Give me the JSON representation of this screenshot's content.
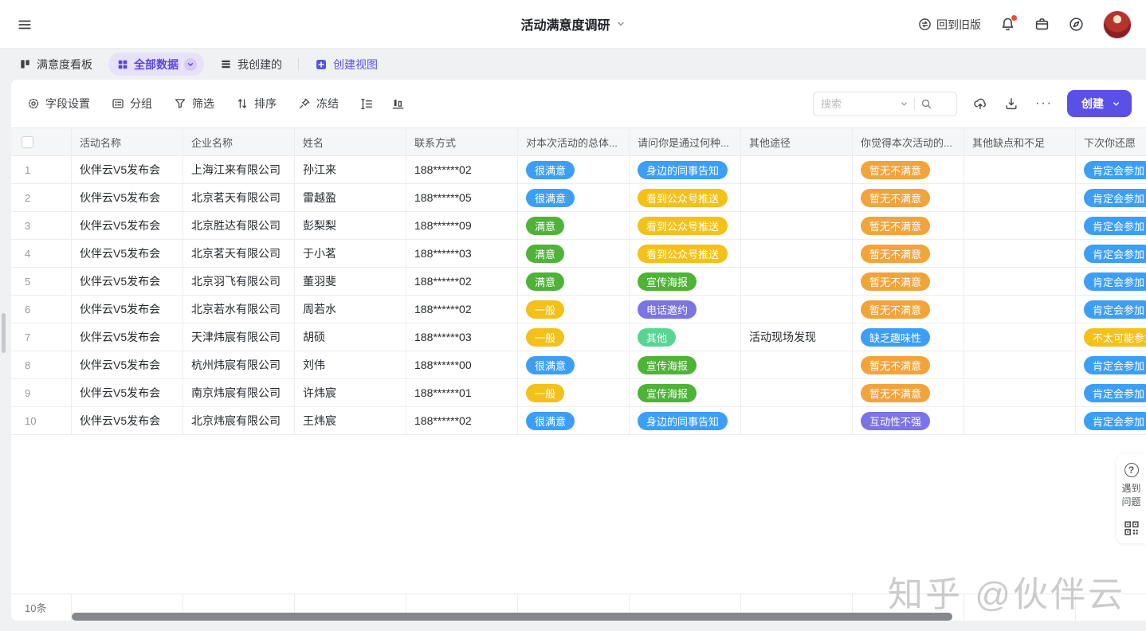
{
  "header": {
    "title": "活动满意度调研",
    "back_to_old_label": "回到旧版"
  },
  "tabs": {
    "kanban_label": "满意度看板",
    "all_data_label": "全部数据",
    "my_created_label": "我创建的",
    "create_view_label": "创建视图"
  },
  "toolbar": {
    "field_settings_label": "字段设置",
    "group_label": "分组",
    "filter_label": "筛选",
    "sort_label": "排序",
    "freeze_label": "冻结",
    "search_placeholder": "搜索",
    "create_label": "创建"
  },
  "colors": {
    "brand_purple": "#5b50e6",
    "tab_pill_bg": "#e7e1fa",
    "tab_pill_text": "#5b44e0"
  },
  "icons": {
    "menu": "hamburger",
    "title_caret": "chevron-down",
    "back_to_old": "circular-swap-arrows",
    "notifications": "bell-with-red-dot",
    "workspace": "briefcase",
    "discover": "compass",
    "kanban_view": "kanban-board",
    "all_data_view": "grid-2x2",
    "my_created_view": "list-rows",
    "create_view": "plus-square",
    "field_settings": "gear",
    "group": "grouping-panel",
    "filter": "funnel",
    "sort": "arrows-up-down",
    "freeze": "pin",
    "row_height": "row-height-ruler",
    "chart": "bar-chart",
    "search": "magnifier",
    "upload": "cloud-up-arrow",
    "download": "down-arrow-tray",
    "more": "ellipsis",
    "help": "question-circle",
    "qr": "qr-code"
  },
  "table": {
    "tag_colors": {
      "blue": "#3d9ef5",
      "green": "#4eb337",
      "yellow": "#f3c117",
      "orange": "#f2a43c",
      "indigo": "#7b74e3",
      "mint": "#56d692"
    },
    "columns": [
      {
        "key": "activity",
        "label": "活动名称",
        "type": "text"
      },
      {
        "key": "company",
        "label": "企业名称",
        "type": "text"
      },
      {
        "key": "person",
        "label": "姓名",
        "type": "text"
      },
      {
        "key": "phone",
        "label": "联系方式",
        "type": "text"
      },
      {
        "key": "overall",
        "label": "对本次活动的总体...",
        "type": "tag"
      },
      {
        "key": "channel",
        "label": "请问你是通过何种...",
        "type": "tag"
      },
      {
        "key": "other_channel",
        "label": "其他途径",
        "type": "text"
      },
      {
        "key": "dislike",
        "label": "你觉得本次活动的...",
        "type": "tag"
      },
      {
        "key": "other_dislike",
        "label": "其他缺点和不足",
        "type": "text"
      },
      {
        "key": "next_join",
        "label": "下次你还愿",
        "type": "tag"
      }
    ],
    "rows": [
      {
        "num": "1",
        "activity": "伙伴云V5发布会",
        "company": "上海江来有限公司",
        "person": "孙江来",
        "phone": "188******02",
        "overall": {
          "label": "很满意",
          "color": "blue"
        },
        "channel": {
          "label": "身边的同事告知",
          "color": "blue"
        },
        "other_channel": "",
        "dislike": {
          "label": "暂无不满意",
          "color": "orange"
        },
        "other_dislike": "",
        "next_join": {
          "label": "肯定会参加",
          "color": "blue"
        }
      },
      {
        "num": "2",
        "activity": "伙伴云V5发布会",
        "company": "北京茗天有限公司",
        "person": "雷越盈",
        "phone": "188******05",
        "overall": {
          "label": "很满意",
          "color": "blue"
        },
        "channel": {
          "label": "看到公众号推送",
          "color": "yellow"
        },
        "other_channel": "",
        "dislike": {
          "label": "暂无不满意",
          "color": "orange"
        },
        "other_dislike": "",
        "next_join": {
          "label": "肯定会参加",
          "color": "blue"
        }
      },
      {
        "num": "3",
        "activity": "伙伴云V5发布会",
        "company": "北京胜达有限公司",
        "person": "彭梨梨",
        "phone": "188******09",
        "overall": {
          "label": "满意",
          "color": "green"
        },
        "channel": {
          "label": "看到公众号推送",
          "color": "yellow"
        },
        "other_channel": "",
        "dislike": {
          "label": "暂无不满意",
          "color": "orange"
        },
        "other_dislike": "",
        "next_join": {
          "label": "肯定会参加",
          "color": "blue"
        }
      },
      {
        "num": "4",
        "activity": "伙伴云V5发布会",
        "company": "北京茗天有限公司",
        "person": "于小茗",
        "phone": "188******03",
        "overall": {
          "label": "满意",
          "color": "green"
        },
        "channel": {
          "label": "看到公众号推送",
          "color": "yellow"
        },
        "other_channel": "",
        "dislike": {
          "label": "暂无不满意",
          "color": "orange"
        },
        "other_dislike": "",
        "next_join": {
          "label": "肯定会参加",
          "color": "blue"
        }
      },
      {
        "num": "5",
        "activity": "伙伴云V5发布会",
        "company": "北京羽飞有限公司",
        "person": "董羽斐",
        "phone": "188******02",
        "overall": {
          "label": "满意",
          "color": "green"
        },
        "channel": {
          "label": "宣传海报",
          "color": "green"
        },
        "other_channel": "",
        "dislike": {
          "label": "暂无不满意",
          "color": "orange"
        },
        "other_dislike": "",
        "next_join": {
          "label": "肯定会参加",
          "color": "blue"
        }
      },
      {
        "num": "6",
        "activity": "伙伴云V5发布会",
        "company": "北京若水有限公司",
        "person": "周若水",
        "phone": "188******02",
        "overall": {
          "label": "一般",
          "color": "yellow"
        },
        "channel": {
          "label": "电话邀约",
          "color": "indigo"
        },
        "other_channel": "",
        "dislike": {
          "label": "暂无不满意",
          "color": "orange"
        },
        "other_dislike": "",
        "next_join": {
          "label": "肯定会参加",
          "color": "blue"
        }
      },
      {
        "num": "7",
        "activity": "伙伴云V5发布会",
        "company": "天津炜宸有限公司",
        "person": "胡硕",
        "phone": "188******03",
        "overall": {
          "label": "一般",
          "color": "yellow"
        },
        "channel": {
          "label": "其他",
          "color": "mint"
        },
        "other_channel": "活动现场发现",
        "dislike": {
          "label": "缺乏趣味性",
          "color": "blue"
        },
        "other_dislike": "",
        "next_join": {
          "label": "不太可能参加",
          "color": "yellow"
        }
      },
      {
        "num": "8",
        "activity": "伙伴云V5发布会",
        "company": "杭州炜宸有限公司",
        "person": "刘伟",
        "phone": "188******00",
        "overall": {
          "label": "很满意",
          "color": "blue"
        },
        "channel": {
          "label": "宣传海报",
          "color": "green"
        },
        "other_channel": "",
        "dislike": {
          "label": "暂无不满意",
          "color": "orange"
        },
        "other_dislike": "",
        "next_join": {
          "label": "肯定会参加",
          "color": "blue"
        }
      },
      {
        "num": "9",
        "activity": "伙伴云V5发布会",
        "company": "南京炜宸有限公司",
        "person": "许炜宸",
        "phone": "188******01",
        "overall": {
          "label": "一般",
          "color": "yellow"
        },
        "channel": {
          "label": "宣传海报",
          "color": "green"
        },
        "other_channel": "",
        "dislike": {
          "label": "暂无不满意",
          "color": "orange"
        },
        "other_dislike": "",
        "next_join": {
          "label": "肯定会参加",
          "color": "blue"
        }
      },
      {
        "num": "10",
        "activity": "伙伴云V5发布会",
        "company": "北京炜宸有限公司",
        "person": "王炜宸",
        "phone": "188******02",
        "overall": {
          "label": "很满意",
          "color": "blue"
        },
        "channel": {
          "label": "身边的同事告知",
          "color": "blue"
        },
        "other_channel": "",
        "dislike": {
          "label": "互动性不强",
          "color": "indigo"
        },
        "other_dislike": "",
        "next_join": {
          "label": "肯定会参加",
          "color": "blue"
        }
      }
    ]
  },
  "footer": {
    "count": "10条"
  },
  "help": {
    "line1": "遇到",
    "line2": "问题"
  },
  "watermark": "知乎 @伙伴云"
}
